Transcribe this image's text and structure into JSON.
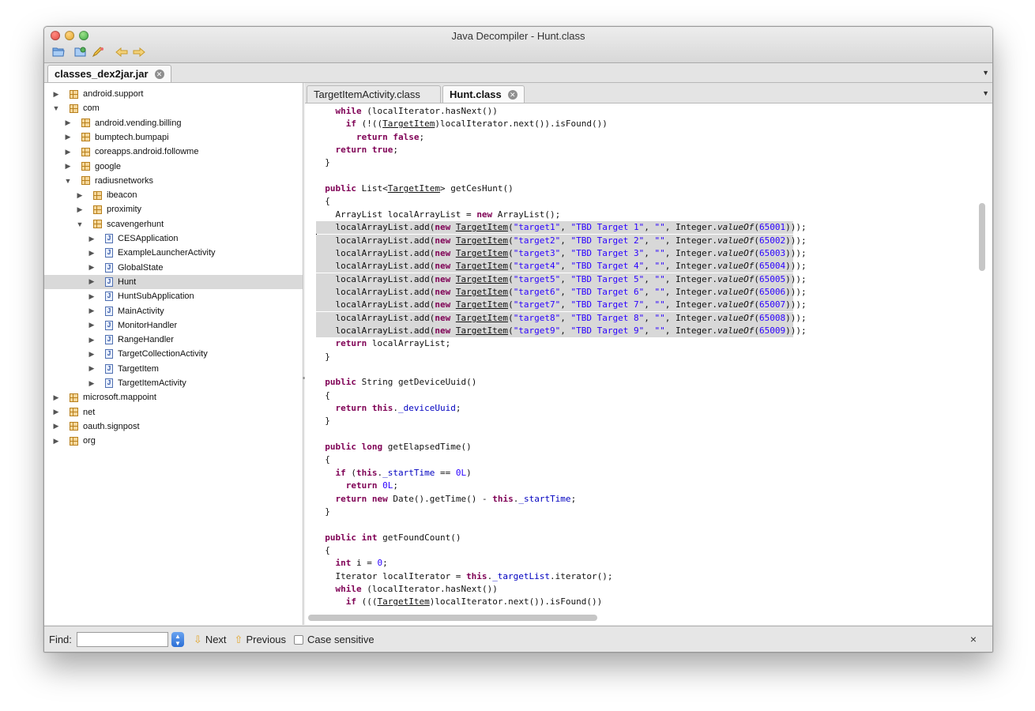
{
  "window": {
    "title": "Java Decompiler - Hunt.class"
  },
  "toolbar": {
    "icons": [
      "open-file-icon",
      "open-folder-icon",
      "edit-icon",
      "back-icon",
      "forward-icon"
    ]
  },
  "jar_tab": {
    "label": "classes_dex2jar.jar"
  },
  "tree": {
    "rows": [
      {
        "label": "android.support",
        "type": "package",
        "expand": "collapsed",
        "depth": 0
      },
      {
        "label": "com",
        "type": "package",
        "expand": "expanded",
        "depth": 0
      },
      {
        "label": "android.vending.billing",
        "type": "package",
        "expand": "collapsed",
        "depth": 1
      },
      {
        "label": "bumptech.bumpapi",
        "type": "package",
        "expand": "collapsed",
        "depth": 1
      },
      {
        "label": "coreapps.android.followme",
        "type": "package",
        "expand": "collapsed",
        "depth": 1
      },
      {
        "label": "google",
        "type": "package",
        "expand": "collapsed",
        "depth": 1
      },
      {
        "label": "radiusnetworks",
        "type": "package",
        "expand": "expanded",
        "depth": 1
      },
      {
        "label": "ibeacon",
        "type": "package",
        "expand": "collapsed",
        "depth": 2
      },
      {
        "label": "proximity",
        "type": "package",
        "expand": "collapsed",
        "depth": 2
      },
      {
        "label": "scavengerhunt",
        "type": "package",
        "expand": "expanded",
        "depth": 2
      },
      {
        "label": "CESApplication",
        "type": "class",
        "expand": "collapsed",
        "depth": 3
      },
      {
        "label": "ExampleLauncherActivity",
        "type": "class",
        "expand": "collapsed",
        "depth": 3
      },
      {
        "label": "GlobalState",
        "type": "class",
        "expand": "collapsed",
        "depth": 3
      },
      {
        "label": "Hunt",
        "type": "class",
        "expand": "collapsed",
        "depth": 3,
        "selected": true
      },
      {
        "label": "HuntSubApplication",
        "type": "class",
        "expand": "collapsed",
        "depth": 3
      },
      {
        "label": "MainActivity",
        "type": "class",
        "expand": "collapsed",
        "depth": 3
      },
      {
        "label": "MonitorHandler",
        "type": "class",
        "expand": "collapsed",
        "depth": 3
      },
      {
        "label": "RangeHandler",
        "type": "class",
        "expand": "collapsed",
        "depth": 3
      },
      {
        "label": "TargetCollectionActivity",
        "type": "class",
        "expand": "collapsed",
        "depth": 3
      },
      {
        "label": "TargetItem",
        "type": "class",
        "expand": "collapsed",
        "depth": 3
      },
      {
        "label": "TargetItemActivity",
        "type": "class",
        "expand": "collapsed",
        "depth": 3
      },
      {
        "label": "microsoft.mappoint",
        "type": "package",
        "expand": "collapsed",
        "depth": 0
      },
      {
        "label": "net",
        "type": "package",
        "expand": "collapsed",
        "depth": 0
      },
      {
        "label": "oauth.signpost",
        "type": "package",
        "expand": "collapsed",
        "depth": 0
      },
      {
        "label": "org",
        "type": "package",
        "expand": "collapsed",
        "depth": 0
      }
    ]
  },
  "editor_tabs": [
    {
      "label": "TargetItemActivity.class",
      "active": false
    },
    {
      "label": "Hunt.class",
      "active": true
    }
  ],
  "code": {
    "lines": [
      "    while (localIterator.hasNext())",
      "      if (!((TargetItem)localIterator.next()).isFound())",
      "        return false;",
      "    return true;",
      "  }",
      "",
      "  public List<TargetItem> getCesHunt()",
      "  {",
      "    ArrayList localArrayList = new ArrayList();",
      "    localArrayList.add(new TargetItem(\"target1\", \"TBD Target 1\", \"\", Integer.valueOf(65001)));",
      "    localArrayList.add(new TargetItem(\"target2\", \"TBD Target 2\", \"\", Integer.valueOf(65002)));",
      "    localArrayList.add(new TargetItem(\"target3\", \"TBD Target 3\", \"\", Integer.valueOf(65003)));",
      "    localArrayList.add(new TargetItem(\"target4\", \"TBD Target 4\", \"\", Integer.valueOf(65004)));",
      "    localArrayList.add(new TargetItem(\"target5\", \"TBD Target 5\", \"\", Integer.valueOf(65005)));",
      "    localArrayList.add(new TargetItem(\"target6\", \"TBD Target 6\", \"\", Integer.valueOf(65006)));",
      "    localArrayList.add(new TargetItem(\"target7\", \"TBD Target 7\", \"\", Integer.valueOf(65007)));",
      "    localArrayList.add(new TargetItem(\"target8\", \"TBD Target 8\", \"\", Integer.valueOf(65008)));",
      "    localArrayList.add(new TargetItem(\"target9\", \"TBD Target 9\", \"\", Integer.valueOf(65009)));",
      "    return localArrayList;",
      "  }",
      "",
      "  public String getDeviceUuid()",
      "  {",
      "    return this._deviceUuid;",
      "  }",
      "",
      "  public long getElapsedTime()",
      "  {",
      "    if (this._startTime == 0L)",
      "      return 0L;",
      "    return new Date().getTime() - this._startTime;",
      "  }",
      "",
      "  public int getFoundCount()",
      "  {",
      "    int i = 0;",
      "    Iterator localIterator = this._targetList.iterator();",
      "    while (localIterator.hasNext())",
      "      if (((TargetItem)localIterator.next()).isFound())"
    ],
    "highlighted_lines": [
      9,
      10,
      11,
      12,
      13,
      14,
      15,
      16,
      17
    ]
  },
  "find_bar": {
    "label": "Find:",
    "input_value": "",
    "next_label": "Next",
    "previous_label": "Previous",
    "case_label": "Case sensitive",
    "case_checked": false,
    "close_glyph": "×"
  }
}
